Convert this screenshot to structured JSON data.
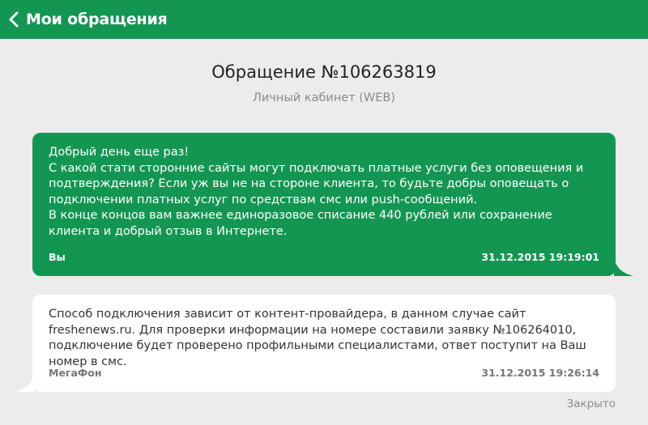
{
  "header": {
    "title": "Мои обращения",
    "back_icon": "chevron-left-icon",
    "background_color": "#149653"
  },
  "ticket": {
    "title": "Обращение №106263819",
    "channel": "Личный кабинет (WEB)",
    "status": "Закрыто"
  },
  "messages": [
    {
      "text": "Добрый день еще раз!\nС какой стати сторонние сайты могут подключать платные услуги без оповещения и подтверждения? Если уж вы не на стороне клиента, то будьте добры оповещать о подключении платных услуг по средствам смс или push-сообщений.\nВ конце концов вам важнее единоразовое списание 440 рублей или сохранение клиента и добрый отзыв в Интернете.",
      "author": "Вы",
      "timestamp": "31.12.2015 19:19:01",
      "bubble_color": "#149653"
    },
    {
      "text": "Способ подключения зависит от контент-провайдера, в данном случае сайт freshenews.ru. Для проверки информации на номере составили заявку №106264010, подключение будет проверено профильными специалистами, ответ поступит на Ваш номер в смс.",
      "author": "МегаФон",
      "timestamp": "31.12.2015 19:26:14",
      "bubble_color": "#ffffff"
    }
  ]
}
